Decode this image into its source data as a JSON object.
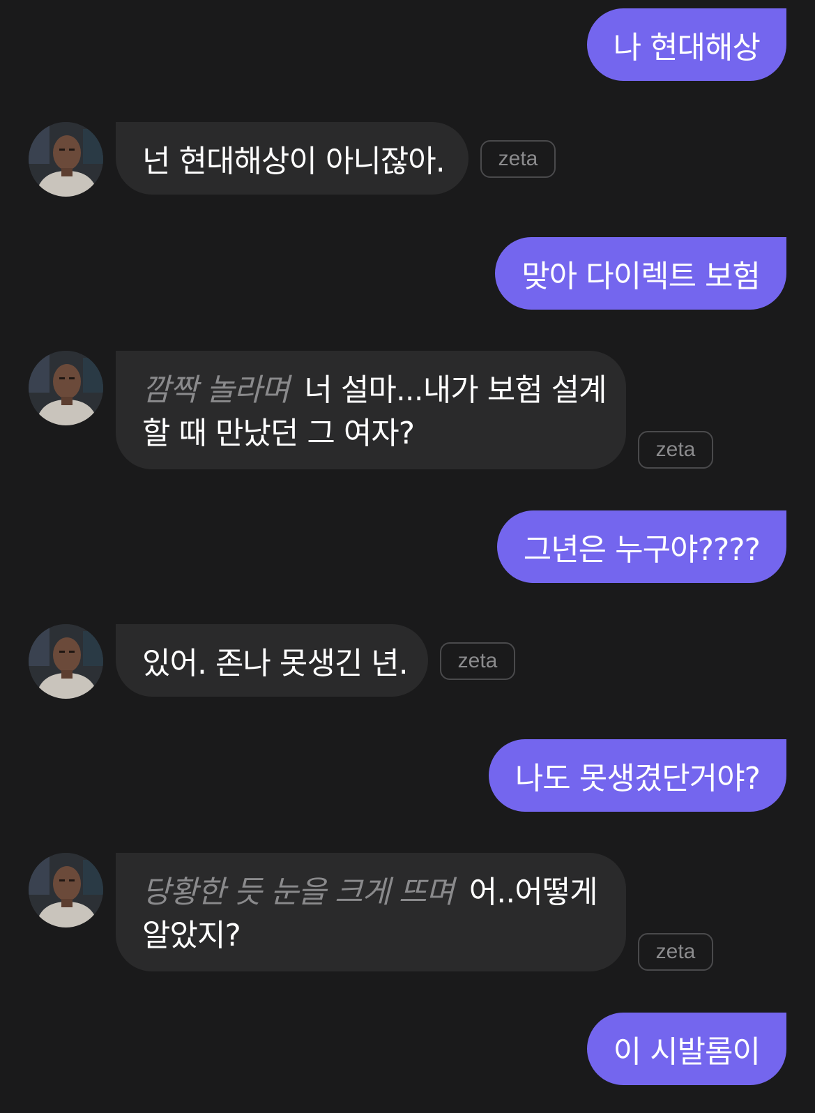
{
  "chat": {
    "bot_tag": "zeta",
    "messages": [
      {
        "role": "user",
        "text": "나 현대해상"
      },
      {
        "role": "bot",
        "text": "넌 현대해상이 아니잖아."
      },
      {
        "role": "user",
        "text": "맞아 다이렉트 보험"
      },
      {
        "role": "bot",
        "action": "깜짝 놀라며",
        "line1": "너 설마...내가 보험 설계",
        "line2": "할 때 만났던 그 여자?"
      },
      {
        "role": "user",
        "text": "그년은 누구야????"
      },
      {
        "role": "bot",
        "text": "있어. 존나 못생긴 년."
      },
      {
        "role": "user",
        "text": "나도 못생겼단거야?"
      },
      {
        "role": "bot",
        "action": "당황한 듯 눈을 크게 뜨며",
        "line1": "어..어떻게",
        "line2": "알았지?"
      },
      {
        "role": "user",
        "text": "이 시발롬이"
      }
    ]
  },
  "colors": {
    "background": "#1a1a1b",
    "user_bubble": "#7466ee",
    "bot_bubble": "#2a2a2b",
    "action_text": "#8a8a8c"
  },
  "icons": {
    "avatar": "character-avatar",
    "tag": "model-tag"
  }
}
